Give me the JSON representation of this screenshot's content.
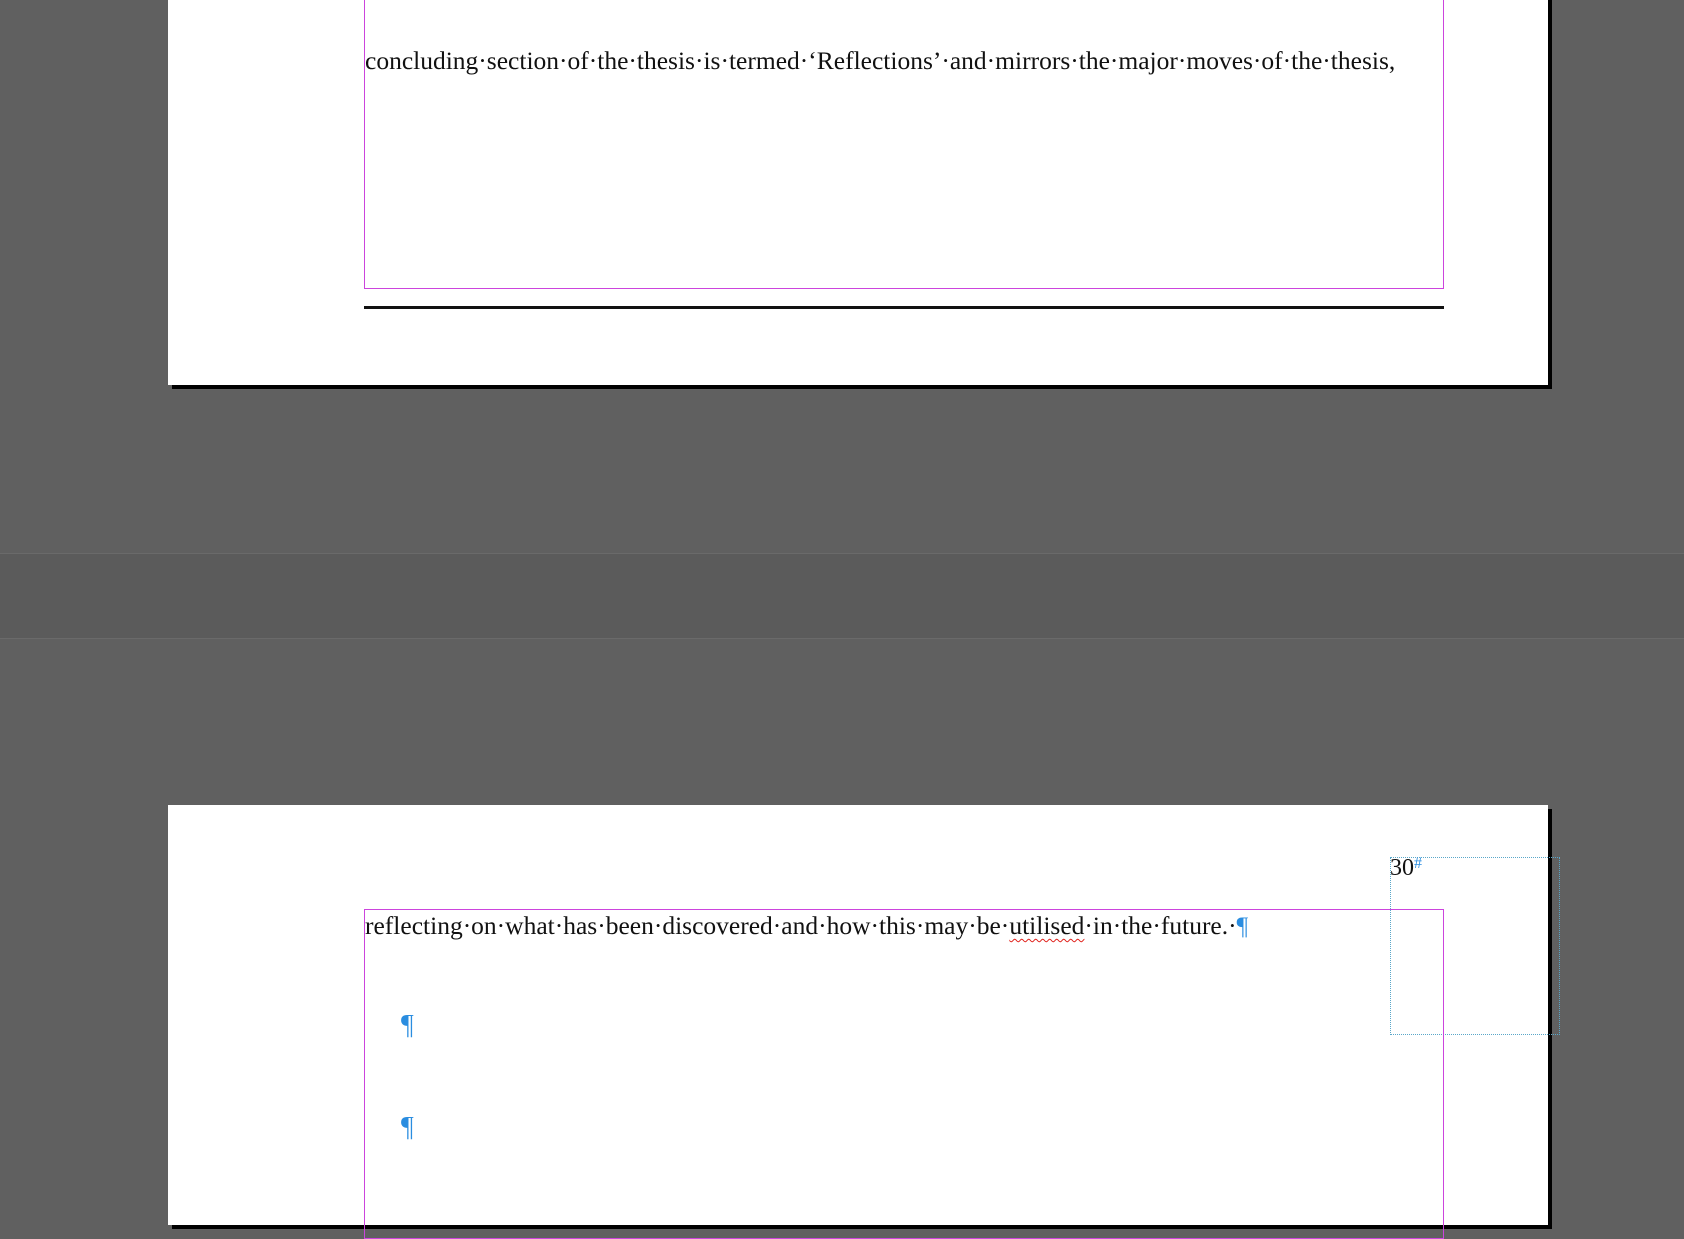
{
  "page_top": {
    "line": "concluding·section·of·the·thesis·is·termed·‘Reflections’·and·mirrors·the·major·moves·of·the·thesis,"
  },
  "page_bottom": {
    "folio_number": "30",
    "folio_marker": "#",
    "line_part1": "reflecting·on·what·has·been·discovered·and·how·this·may·be·",
    "misspelled_word": "utilised",
    "line_part2": "·in·the·future.·",
    "pilcrow": "¶",
    "empty_paragraph_1": "¶",
    "empty_paragraph_2": "¶"
  },
  "colors": {
    "pasteboard": "#606060",
    "frame_edge": "#cc44dd",
    "hidden_chars": "#2a8de0",
    "spell_error": "#e0201a"
  }
}
